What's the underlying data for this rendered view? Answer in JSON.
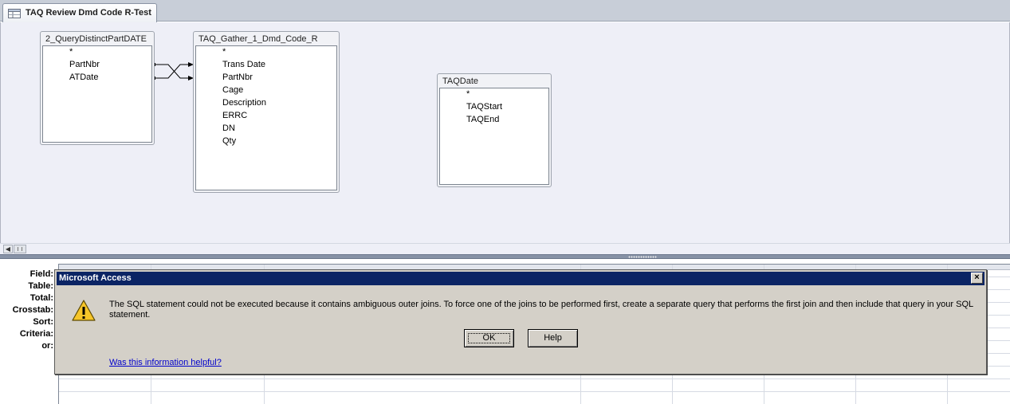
{
  "tab": {
    "title": "TAQ Review Dmd Code R-Test",
    "icon": "query-icon"
  },
  "field_lists": [
    {
      "title": "2_QueryDistinctPartDATE",
      "fields": [
        "*",
        "PartNbr",
        "ATDate"
      ]
    },
    {
      "title": "TAQ_Gather_1_Dmd_Code_R",
      "fields": [
        "*",
        "Trans Date",
        "PartNbr",
        "Cage",
        "Description",
        "ERRC",
        "DN",
        "Qty"
      ]
    },
    {
      "title": "TAQDate",
      "fields": [
        "*",
        "TAQStart",
        "TAQEnd"
      ]
    }
  ],
  "grid": {
    "row_labels": [
      "Field:",
      "Table:",
      "Total:",
      "Crosstab:",
      "Sort:",
      "Criteria:",
      "or:"
    ]
  },
  "dialog": {
    "title": "Microsoft Access",
    "close_label": "×",
    "icon": "warning-icon",
    "message": "The SQL statement could not be executed because it contains ambiguous outer joins. To force one of the joins to be performed first, create a separate query that performs the first join and then include that query in your SQL statement.",
    "ok_label": "OK",
    "help_label": "Help",
    "helpful_link": "Was this information helpful?"
  },
  "colors": {
    "dialog_titlebar": "#0b2464",
    "design_background": "#eeeff7",
    "splitter": "#8792a6",
    "link": "#0000cc"
  }
}
